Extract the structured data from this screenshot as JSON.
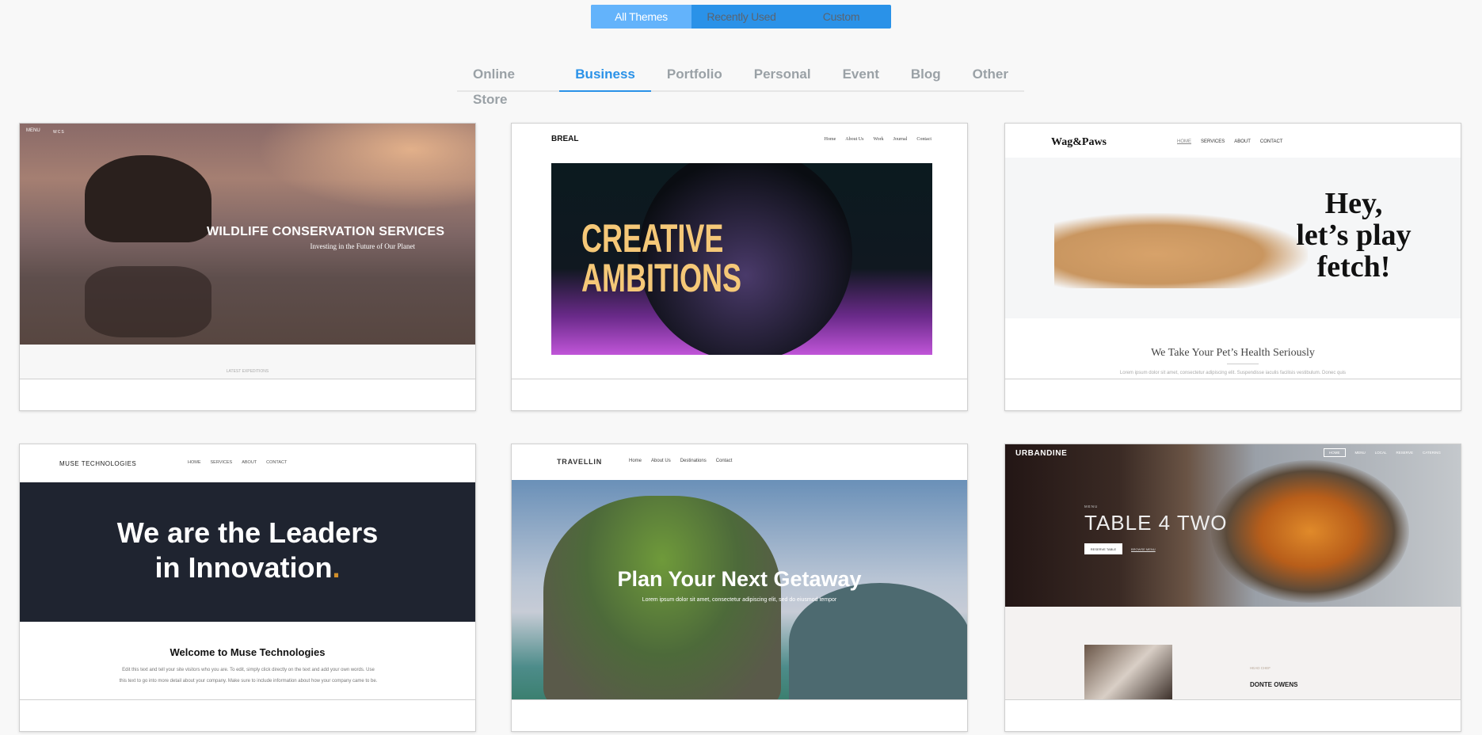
{
  "filter_tabs": [
    {
      "label": "All Themes",
      "active": true
    },
    {
      "label": "Recently Used",
      "active": false
    },
    {
      "label": "Custom",
      "active": false
    }
  ],
  "categories": [
    {
      "label": "Online Store"
    },
    {
      "label": "Business",
      "active": true
    },
    {
      "label": "Portfolio"
    },
    {
      "label": "Personal"
    },
    {
      "label": "Event"
    },
    {
      "label": "Blog"
    },
    {
      "label": "Other"
    }
  ],
  "accent": "#2a92e8",
  "themes": [
    {
      "nav": [
        "MENU",
        "WCS"
      ],
      "title": "WILDLIFE CONSERVATION SERVICES",
      "subtitle": "Investing in the Future of Our Planet",
      "section": "LATEST EXPEDITIONS"
    },
    {
      "logo": "BREAL",
      "nav": [
        "Home",
        "About Us",
        "Work",
        "Journal",
        "Contact"
      ],
      "hero_line1": "CREATIVE",
      "hero_line2": "AMBITIONS"
    },
    {
      "logo": "Wag&Paws",
      "nav": [
        "HOME",
        "SERVICES",
        "ABOUT",
        "CONTACT"
      ],
      "hero_line1": "Hey,",
      "hero_line2": "let’s play",
      "hero_line3": "fetch!",
      "heading": "We Take Your Pet’s Health Seriously",
      "body": "Lorem ipsum dolor sit amet, consectetur adipiscing elit. Suspendisse iaculis facilisis vestibulum. Donec quis"
    },
    {
      "logo": "MUSE TECHNOLOGIES",
      "nav": [
        "HOME",
        "SERVICES",
        "ABOUT",
        "CONTACT"
      ],
      "hero_line1": "We are the Leaders",
      "hero_line2": "in Innovation",
      "hero_dot": ".",
      "heading": "Welcome to Muse Technologies",
      "body": "Edit this text and tell your site visitors who you are. To edit, simply click directly on the text and add your own words. Use this text to go into more detail about your company. Make sure to include information about how your company came to be."
    },
    {
      "logo": "TRAVELLIN",
      "nav": [
        "Home",
        "About Us",
        "Destinations",
        "Contact"
      ],
      "title": "Plan Your Next Getaway",
      "subtitle": "Lorem ipsum dolor sit amet, consectetur adipiscing elit, sed do eiusmod tempor"
    },
    {
      "logo": "URBANDINE",
      "nav": [
        "HOME",
        "MENU",
        "LOCAL",
        "RESERVE",
        "CATERING"
      ],
      "eyebrow": "MENU",
      "title": "TABLE 4 TWO",
      "btn_primary": "RESERVE TABLE",
      "btn_link": "BROWSE MENU",
      "chef_label": "HEAD CHEF",
      "chef_name": "DONTE OWENS"
    }
  ]
}
